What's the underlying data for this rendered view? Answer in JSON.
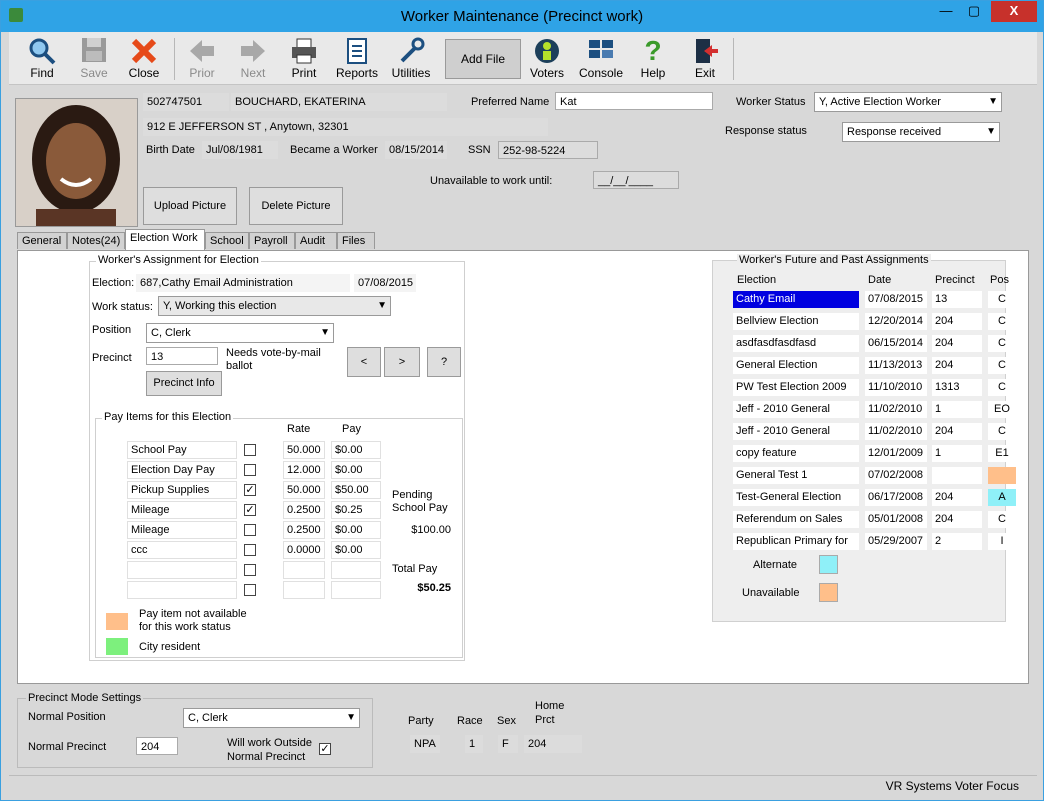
{
  "window": {
    "title": "Worker Maintenance (Precinct work)",
    "min": "—",
    "max": "▢",
    "close": "X"
  },
  "toolbar": {
    "find": "Find",
    "save": "Save",
    "close": "Close",
    "prior": "Prior",
    "next": "Next",
    "print": "Print",
    "reports": "Reports",
    "utilities": "Utilities",
    "add_file": "Add File",
    "voters": "Voters",
    "console": "Console",
    "help": "Help",
    "exit": "Exit"
  },
  "worker": {
    "id": "502747501",
    "name": "BOUCHARD, EKATERINA",
    "preferred_label": "Preferred Name",
    "preferred": "Kat",
    "address": "912 E JEFFERSON ST , Anytown, 32301",
    "birth_label": "Birth Date",
    "birth": "Jul/08/1981",
    "became_label": "Became a Worker",
    "became": "08/15/2014",
    "ssn_label": "SSN",
    "ssn": "252-98-5224",
    "unavail_label": "Unavailable to work until:",
    "unavail": "__/__/____",
    "status_label": "Worker Status",
    "status": "Y, Active Election Worker",
    "response_label": "Response status",
    "response": "Response received",
    "upload": "Upload Picture",
    "delete": "Delete Picture"
  },
  "tabs": [
    "General",
    "Notes(24)",
    "Election Work",
    "School",
    "Payroll",
    "Audit",
    "Files"
  ],
  "assignment": {
    "title": "Worker's Assignment for Election",
    "election_label": "Election:",
    "election": "687,Cathy Email Administration",
    "election_date": "07/08/2015",
    "work_status_label": "Work status:",
    "work_status": "Y, Working this election",
    "position_label": "Position",
    "position": "C, Clerk",
    "precinct_label": "Precinct",
    "precinct": "13",
    "vbm": "Needs vote-by-mail ballot",
    "precinct_info": "Precinct Info",
    "prev": "<",
    "next": ">",
    "help": "?"
  },
  "pay": {
    "title": "Pay Items for this Election",
    "rate_header": "Rate",
    "pay_header": "Pay",
    "rows": [
      {
        "name": "School Pay",
        "checked": false,
        "rate": "50.000",
        "pay": "$0.00"
      },
      {
        "name": "Election Day Pay",
        "checked": false,
        "rate": "12.000",
        "pay": "$0.00"
      },
      {
        "name": "Pickup Supplies",
        "checked": true,
        "rate": "50.000",
        "pay": "$50.00"
      },
      {
        "name": "Mileage",
        "checked": true,
        "rate": "0.2500",
        "pay": "$0.25"
      },
      {
        "name": "Mileage",
        "checked": false,
        "rate": "0.2500",
        "pay": "$0.00"
      },
      {
        "name": "ccc",
        "checked": false,
        "rate": "0.0000",
        "pay": "$0.00"
      },
      {
        "name": "",
        "checked": false,
        "rate": "",
        "pay": ""
      },
      {
        "name": "",
        "checked": false,
        "rate": "",
        "pay": ""
      }
    ],
    "pending_label": "Pending School Pay",
    "pending": "$100.00",
    "total_label": "Total Pay",
    "total": "$50.25",
    "legend_unavail": "Pay item not available for this work status",
    "legend_city": "City resident",
    "color_unavail": "#ffbf8a",
    "color_city": "#7df07d"
  },
  "assignments": {
    "title": "Worker's Future and Past Assignments",
    "headers": [
      "Election",
      "Date",
      "Precinct",
      "Pos"
    ],
    "rows": [
      {
        "election": "Cathy Email",
        "date": "07/08/2015",
        "precinct": "13",
        "pos": "C",
        "selected": true,
        "flag": ""
      },
      {
        "election": "Bellview Election",
        "date": "12/20/2014",
        "precinct": "204",
        "pos": "C",
        "flag": ""
      },
      {
        "election": "asdfasdfasdfasd",
        "date": "06/15/2014",
        "precinct": "204",
        "pos": "C",
        "flag": ""
      },
      {
        "election": "General Election",
        "date": "11/13/2013",
        "precinct": "204",
        "pos": "C",
        "flag": ""
      },
      {
        "election": "PW Test Election 2009",
        "date": "11/10/2010",
        "precinct": "1313",
        "pos": "C",
        "flag": ""
      },
      {
        "election": "Jeff - 2010 General",
        "date": "11/02/2010",
        "precinct": "1",
        "pos": "EO",
        "flag": ""
      },
      {
        "election": "Jeff - 2010 General",
        "date": "11/02/2010",
        "precinct": "204",
        "pos": "C",
        "flag": ""
      },
      {
        "election": "copy feature",
        "date": "12/01/2009",
        "precinct": "1",
        "pos": "E1",
        "flag": ""
      },
      {
        "election": "General Test 1",
        "date": "07/02/2008",
        "precinct": "",
        "pos": "",
        "flag": "unavailable"
      },
      {
        "election": "Test-General Election",
        "date": "06/17/2008",
        "precinct": "204",
        "pos": "A",
        "flag": "alternate"
      },
      {
        "election": "Referendum on Sales",
        "date": "05/01/2008",
        "precinct": "204",
        "pos": "C",
        "flag": ""
      },
      {
        "election": "Republican Primary for",
        "date": "05/29/2007",
        "precinct": "2",
        "pos": "I",
        "flag": ""
      }
    ],
    "alternate_label": "Alternate",
    "unavailable_label": "Unavailable",
    "color_alternate": "#8ff0f8",
    "color_unavailable": "#ffbf8a",
    "color_selected": "#0000e0"
  },
  "precinct_mode": {
    "title": "Precinct Mode Settings",
    "normal_position_label": "Normal Position",
    "normal_position": "C, Clerk",
    "normal_precinct_label": "Normal Precinct",
    "normal_precinct": "204",
    "outside_label": "Will work Outside Normal Precinct",
    "outside_checked": true
  },
  "voter": {
    "party_label": "Party",
    "party": "NPA",
    "race_label": "Race",
    "race": "1",
    "sex_label": "Sex",
    "sex": "F",
    "home_label": "Home Prct",
    "home": "204"
  },
  "status": {
    "brand": "VR Systems Voter Focus"
  }
}
